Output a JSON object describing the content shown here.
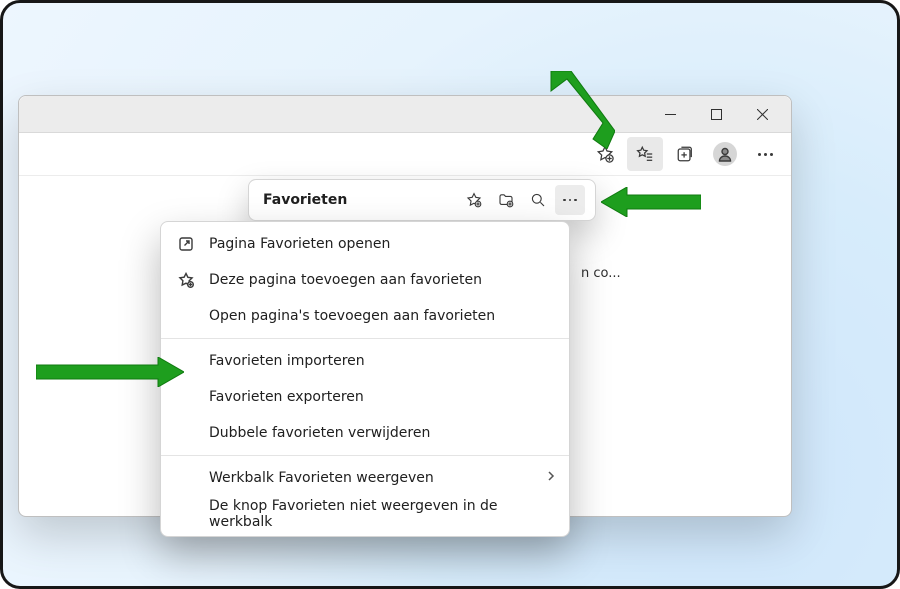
{
  "toolbar": {
    "add_favorite_tooltip": "Deze pagina toevoegen aan favorieten",
    "favorites_tooltip": "Favorieten",
    "collections_tooltip": "Verzamelingen",
    "profile_tooltip": "Profiel",
    "more_tooltip": "Instellingen en meer"
  },
  "favorites_panel": {
    "title": "Favorieten",
    "add_tooltip": "Deze pagina toevoegen aan favorieten",
    "add_folder_tooltip": "Map toevoegen",
    "search_tooltip": "Favorieten zoeken",
    "more_tooltip": "Meer opties",
    "preview_text": "n co..."
  },
  "menu": {
    "open_page": "Pagina Favorieten openen",
    "add_this_page": "Deze pagina toevoegen aan favorieten",
    "add_open_pages": "Open pagina's toevoegen aan favorieten",
    "import": "Favorieten importeren",
    "export": "Favorieten exporteren",
    "remove_duplicates": "Dubbele favorieten verwijderen",
    "show_toolbar": "Werkbalk Favorieten weergeven",
    "hide_button": "De knop Favorieten niet weergeven in de werkbalk"
  },
  "annotations": {
    "arrow1_target": "favorites-button",
    "arrow2_target": "favorites-more-button",
    "arrow3_target": "menu-export"
  }
}
